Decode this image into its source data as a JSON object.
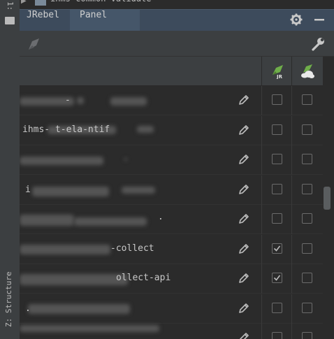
{
  "left_strip": {
    "project_label": "1:",
    "structure_label": "Z: Structure"
  },
  "top_fragment": {
    "text": "ihms-common-validate"
  },
  "tabs": [
    {
      "label": "JRebel",
      "selected": false
    },
    {
      "label": "Panel",
      "selected": true
    }
  ],
  "tab_actions": {
    "settings_icon": "gear-icon",
    "minimize_icon": "minimize-icon"
  },
  "toolbar": {
    "left_icon": "jrebel-rocket-icon",
    "right_icon": "wrench-icon"
  },
  "table": {
    "header_icons": [
      "jrebel-jr-icon",
      "jrebel-cloud-icon"
    ],
    "rows": [
      {
        "name": "-",
        "jrebel": false,
        "remote": false
      },
      {
        "name": "ihms-          t-ela-ntif",
        "jrebel": false,
        "remote": false
      },
      {
        "name": "",
        "jrebel": false,
        "remote": false
      },
      {
        "name": "i",
        "jrebel": false,
        "remote": false
      },
      {
        "name": ".",
        "jrebel": false,
        "remote": false
      },
      {
        "name": "-collect",
        "jrebel": true,
        "remote": false
      },
      {
        "name": "ollect-api",
        "jrebel": true,
        "remote": false
      },
      {
        "name": ".",
        "jrebel": false,
        "remote": false
      },
      {
        "name": "ihms-resource-dict-api",
        "jrebel": false,
        "remote": false
      }
    ]
  },
  "colors": {
    "tab_bar": "#3d4b5c",
    "panel": "#3c3f41",
    "table_bg": "#2b2b2b",
    "jrebel_green": "#6fae4a"
  }
}
